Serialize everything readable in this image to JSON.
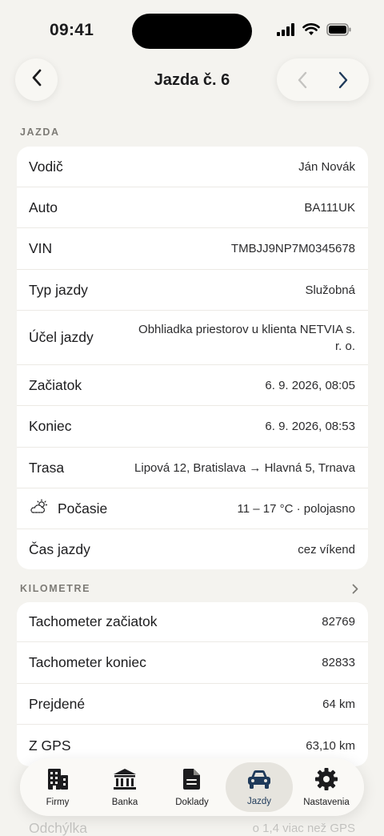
{
  "status_bar": {
    "time": "09:41"
  },
  "nav": {
    "title": "Jazda č. 6"
  },
  "sections": {
    "jazda": {
      "header": "JAZDA",
      "rows": [
        {
          "label": "Vodič",
          "value": "Ján Novák"
        },
        {
          "label": "Auto",
          "value": "BA111UK"
        },
        {
          "label": "VIN",
          "value": "TMBJJ9NP7M0345678"
        },
        {
          "label": "Typ jazdy",
          "value": "Služobná"
        },
        {
          "label": "Účel jazdy",
          "value": "Obhliadka priestorov u klienta NETVIA s. r. o."
        },
        {
          "label": "Začiatok",
          "value": "6. 9. 2026, 08:05"
        },
        {
          "label": "Koniec",
          "value": "6. 9. 2026, 08:53"
        },
        {
          "label": "Trasa",
          "value": "Lipová 12, Bratislava → Hlavná 5, Trnava"
        },
        {
          "label": "Počasie",
          "value": "11 – 17 °C · polojasno",
          "icon": "cloud-sun-icon"
        },
        {
          "label": "Čas jazdy",
          "value": "cez víkend"
        }
      ]
    },
    "kilometre": {
      "header": "KILOMETRE",
      "rows": [
        {
          "label": "Tachometer začiatok",
          "value": "82769"
        },
        {
          "label": "Tachometer koniec",
          "value": "82833"
        },
        {
          "label": "Prejdené",
          "value": "64 km"
        },
        {
          "label": "Z GPS",
          "value": "63,10 km"
        },
        {
          "label": "Odchýlka",
          "value": "o 1,4  viac než GPS"
        }
      ]
    }
  },
  "tabbar": {
    "tabs": [
      {
        "label": "Firmy",
        "icon": "building-icon",
        "active": false
      },
      {
        "label": "Banka",
        "icon": "bank-icon",
        "active": false
      },
      {
        "label": "Doklady",
        "icon": "document-icon",
        "active": false
      },
      {
        "label": "Jazdy",
        "icon": "car-icon",
        "active": true
      },
      {
        "label": "Nastavenia",
        "icon": "gear-icon",
        "active": false
      }
    ]
  },
  "colors": {
    "background": "#f4f3ef",
    "card": "#ffffff",
    "accent": "#1f3a5a",
    "muted": "#7d7b76"
  }
}
